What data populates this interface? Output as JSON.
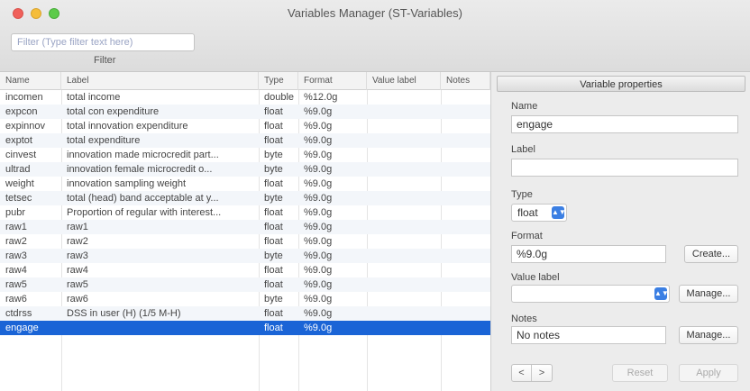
{
  "window": {
    "title": "Variables Manager (ST-Variables)"
  },
  "toolbar": {
    "filter_placeholder": "Filter (Type filter text here)",
    "filter_label": "Filter"
  },
  "table": {
    "columns": [
      "Name",
      "Label",
      "Type",
      "Format",
      "Value label",
      "Notes"
    ],
    "rows": [
      [
        "incomen",
        "total income",
        "double",
        "%12.0g",
        "",
        ""
      ],
      [
        "expcon",
        "total con expenditure",
        "float",
        "%9.0g",
        "",
        ""
      ],
      [
        "expinnov",
        "total innovation expenditure",
        "float",
        "%9.0g",
        "",
        ""
      ],
      [
        "exptot",
        "total expenditure",
        "float",
        "%9.0g",
        "",
        ""
      ],
      [
        "cinvest",
        "innovation made microcredit part...",
        "byte",
        "%9.0g",
        "",
        ""
      ],
      [
        "ultrad",
        "innovation female microcredit o...",
        "byte",
        "%9.0g",
        "",
        ""
      ],
      [
        "weight",
        "innovation sampling weight",
        "float",
        "%9.0g",
        "",
        ""
      ],
      [
        "tetsec",
        "total (head) band acceptable at y...",
        "byte",
        "%9.0g",
        "",
        ""
      ],
      [
        "pubr",
        "Proportion of regular with interest...",
        "float",
        "%9.0g",
        "",
        ""
      ],
      [
        "raw1",
        "raw1",
        "float",
        "%9.0g",
        "",
        ""
      ],
      [
        "raw2",
        "raw2",
        "float",
        "%9.0g",
        "",
        ""
      ],
      [
        "raw3",
        "raw3",
        "byte",
        "%9.0g",
        "",
        ""
      ],
      [
        "raw4",
        "raw4",
        "float",
        "%9.0g",
        "",
        ""
      ],
      [
        "raw5",
        "raw5",
        "float",
        "%9.0g",
        "",
        ""
      ],
      [
        "raw6",
        "raw6",
        "byte",
        "%9.0g",
        "",
        ""
      ],
      [
        "ctdrss",
        "DSS in user  (H)  (1/5 M-H)",
        "float",
        "%9.0g",
        "",
        ""
      ],
      [
        "engage",
        "",
        "float",
        "%9.0g",
        "",
        ""
      ]
    ],
    "selected_index": 16
  },
  "panel": {
    "header": "Variable properties",
    "name_label": "Name",
    "name_value": "engage",
    "label_label": "Label",
    "label_value": "",
    "type_label": "Type",
    "type_value": "float",
    "format_label": "Format",
    "format_value": "%9.0g",
    "create_button": "Create...",
    "value_label_label": "Value label",
    "value_label_value": "",
    "manage_button_1": "Manage...",
    "notes_label": "Notes",
    "notes_value": "No notes",
    "manage_button_2": "Manage...",
    "prev_glyph": "<",
    "next_glyph": ">",
    "reset_button": "Reset",
    "apply_button": "Apply"
  },
  "colors": {
    "selection": "#1a64d6",
    "popup_arrow": "#3b7fe3"
  }
}
